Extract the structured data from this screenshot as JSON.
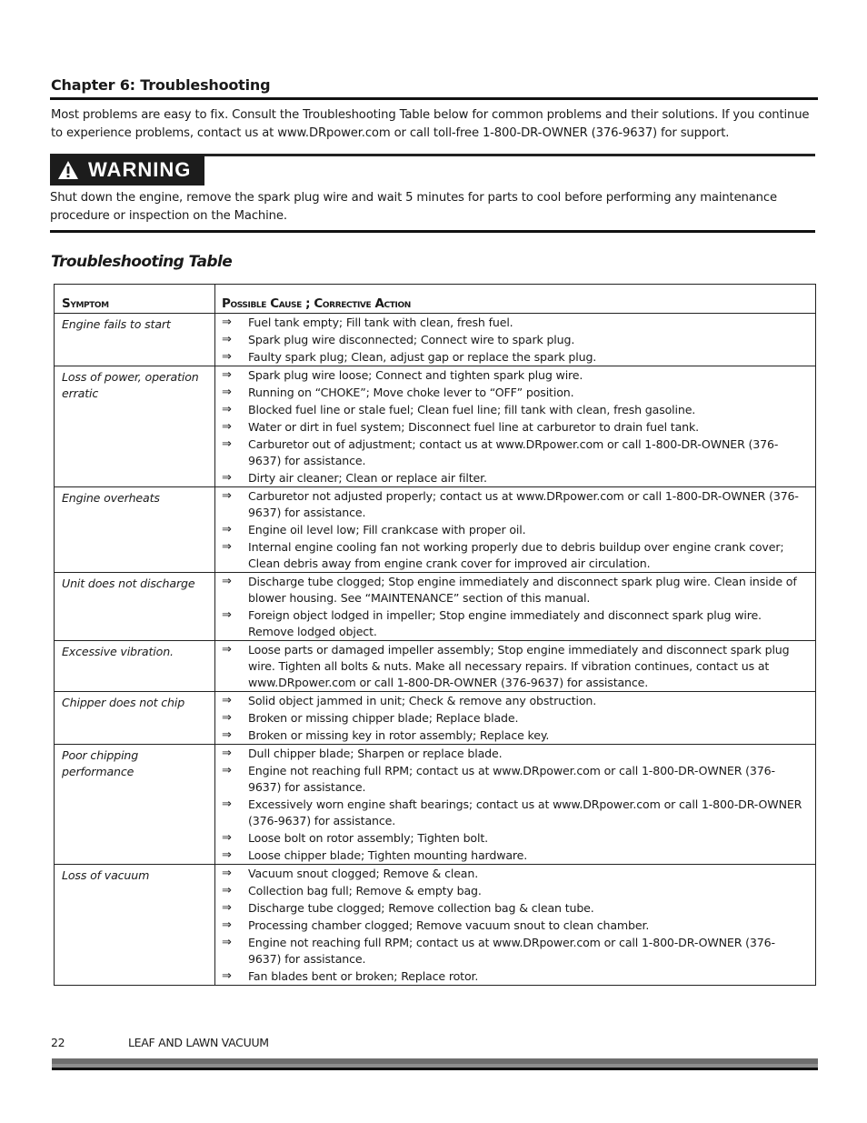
{
  "chapter": {
    "title": "Chapter 6: Troubleshooting",
    "intro": "Most problems are easy to fix. Consult the Troubleshooting Table below for common problems and their solutions. If you continue to experience problems, contact us at www.DRpower.com or call toll-free 1-800-DR-OWNER (376-9637) for support."
  },
  "warning": {
    "icon": "warning-triangle-icon",
    "label": "WARNING",
    "text": "Shut down the engine, remove the spark plug wire and wait 5 minutes for parts to cool before performing any maintenance procedure or inspection on the Machine."
  },
  "table": {
    "title": "Troubleshooting Table",
    "headers": [
      "Symptom",
      "Possible Cause ; Corrective Action"
    ],
    "arrow_glyph": "⇒",
    "rows": [
      {
        "symptom": "Engine fails to start",
        "actions": [
          "Fuel tank empty; Fill tank with clean, fresh fuel.",
          "Spark plug wire disconnected; Connect wire to spark plug.",
          "Faulty spark plug; Clean, adjust gap or replace the spark plug."
        ]
      },
      {
        "symptom": "Loss of power, operation erratic",
        "actions": [
          "Spark plug wire loose; Connect and tighten spark plug wire.",
          "Running on “CHOKE”; Move choke lever to “OFF” position.",
          "Blocked fuel line or stale fuel; Clean fuel line; fill tank with clean, fresh gasoline.",
          "Water or dirt in fuel system; Disconnect fuel line at carburetor to drain fuel tank.",
          "Carburetor out of adjustment; contact us at www.DRpower.com or call 1-800-DR-OWNER (376-9637) for assistance.",
          "Dirty air cleaner; Clean or replace air filter."
        ]
      },
      {
        "symptom": "Engine overheats",
        "actions": [
          "Carburetor not adjusted properly; contact us at www.DRpower.com or call 1-800-DR-OWNER (376-9637) for assistance.",
          "Engine oil level low; Fill crankcase with proper oil.",
          "Internal engine cooling fan not working properly due to debris buildup over engine crank cover; Clean debris away from engine crank cover for improved air circulation."
        ]
      },
      {
        "symptom": "Unit does not discharge",
        "actions": [
          "Discharge tube clogged; Stop engine immediately and disconnect spark plug wire.  Clean inside of blower housing.  See “MAINTENANCE” section of this manual.",
          "Foreign object lodged in impeller; Stop engine immediately and disconnect spark plug wire. Remove lodged object."
        ]
      },
      {
        "symptom": "Excessive vibration.",
        "actions": [
          "Loose parts or damaged impeller assembly; Stop engine immediately and disconnect spark plug wire.  Tighten all bolts & nuts.  Make all necessary repairs.  If vibration continues, contact us at www.DRpower.com or call 1-800-DR-OWNER (376-9637) for assistance."
        ]
      },
      {
        "symptom": "Chipper does not chip",
        "actions": [
          "Solid object jammed in unit;  Check & remove any obstruction.",
          "Broken or missing chipper blade; Replace blade.",
          "Broken or missing key in rotor assembly; Replace key."
        ]
      },
      {
        "symptom": "Poor chipping performance",
        "actions": [
          "Dull chipper blade; Sharpen or replace blade.",
          "Engine not reaching full RPM; contact us at www.DRpower.com or call 1-800-DR-OWNER (376-9637) for assistance.",
          "Excessively worn engine shaft bearings; contact us at www.DRpower.com or call 1-800-DR-OWNER (376-9637) for assistance.",
          "Loose bolt on rotor assembly; Tighten bolt.",
          "Loose chipper blade; Tighten mounting hardware."
        ]
      },
      {
        "symptom": "Loss of vacuum",
        "actions": [
          "Vacuum snout clogged; Remove & clean.",
          "Collection bag full; Remove & empty bag.",
          "Discharge tube clogged; Remove collection bag & clean tube.",
          "Processing chamber clogged; Remove vacuum snout to clean chamber.",
          "Engine not reaching full  RPM; contact us at www.DRpower.com or call 1-800-DR-OWNER (376-9637) for assistance.",
          "Fan blades bent or broken; Replace rotor."
        ]
      }
    ]
  },
  "footer": {
    "page_number": "22",
    "document_title": "LEAF AND LAWN VACUUM"
  }
}
